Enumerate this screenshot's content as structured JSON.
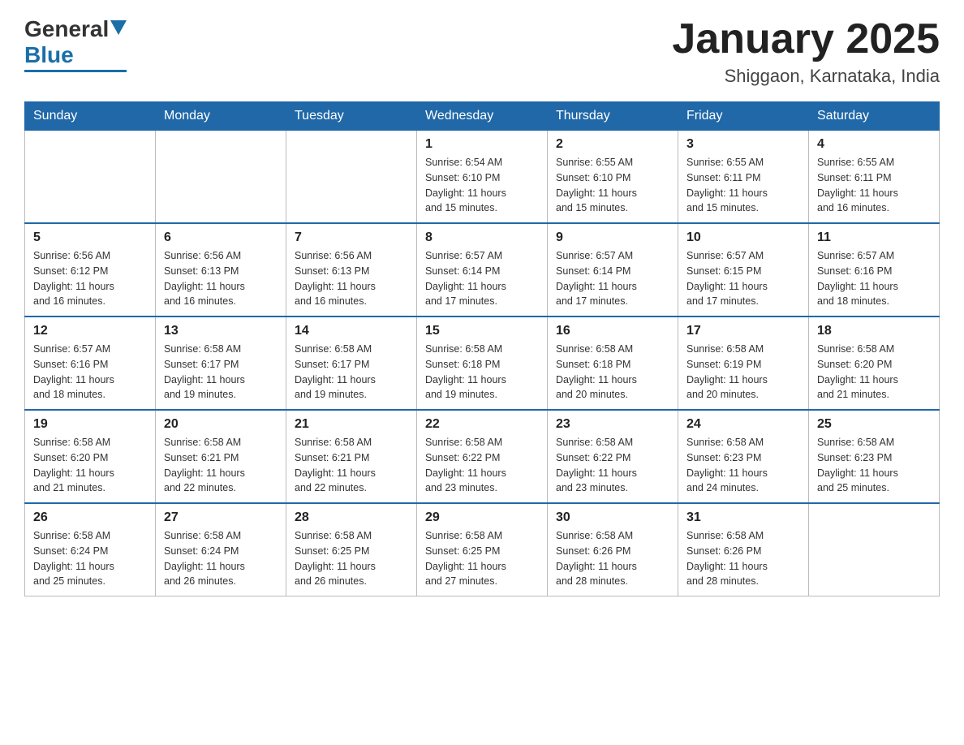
{
  "header": {
    "logo_general": "General",
    "logo_blue": "Blue",
    "title": "January 2025",
    "subtitle": "Shiggaon, Karnataka, India"
  },
  "days_of_week": [
    "Sunday",
    "Monday",
    "Tuesday",
    "Wednesday",
    "Thursday",
    "Friday",
    "Saturday"
  ],
  "weeks": [
    [
      {
        "day": "",
        "info": ""
      },
      {
        "day": "",
        "info": ""
      },
      {
        "day": "",
        "info": ""
      },
      {
        "day": "1",
        "info": "Sunrise: 6:54 AM\nSunset: 6:10 PM\nDaylight: 11 hours\nand 15 minutes."
      },
      {
        "day": "2",
        "info": "Sunrise: 6:55 AM\nSunset: 6:10 PM\nDaylight: 11 hours\nand 15 minutes."
      },
      {
        "day": "3",
        "info": "Sunrise: 6:55 AM\nSunset: 6:11 PM\nDaylight: 11 hours\nand 15 minutes."
      },
      {
        "day": "4",
        "info": "Sunrise: 6:55 AM\nSunset: 6:11 PM\nDaylight: 11 hours\nand 16 minutes."
      }
    ],
    [
      {
        "day": "5",
        "info": "Sunrise: 6:56 AM\nSunset: 6:12 PM\nDaylight: 11 hours\nand 16 minutes."
      },
      {
        "day": "6",
        "info": "Sunrise: 6:56 AM\nSunset: 6:13 PM\nDaylight: 11 hours\nand 16 minutes."
      },
      {
        "day": "7",
        "info": "Sunrise: 6:56 AM\nSunset: 6:13 PM\nDaylight: 11 hours\nand 16 minutes."
      },
      {
        "day": "8",
        "info": "Sunrise: 6:57 AM\nSunset: 6:14 PM\nDaylight: 11 hours\nand 17 minutes."
      },
      {
        "day": "9",
        "info": "Sunrise: 6:57 AM\nSunset: 6:14 PM\nDaylight: 11 hours\nand 17 minutes."
      },
      {
        "day": "10",
        "info": "Sunrise: 6:57 AM\nSunset: 6:15 PM\nDaylight: 11 hours\nand 17 minutes."
      },
      {
        "day": "11",
        "info": "Sunrise: 6:57 AM\nSunset: 6:16 PM\nDaylight: 11 hours\nand 18 minutes."
      }
    ],
    [
      {
        "day": "12",
        "info": "Sunrise: 6:57 AM\nSunset: 6:16 PM\nDaylight: 11 hours\nand 18 minutes."
      },
      {
        "day": "13",
        "info": "Sunrise: 6:58 AM\nSunset: 6:17 PM\nDaylight: 11 hours\nand 19 minutes."
      },
      {
        "day": "14",
        "info": "Sunrise: 6:58 AM\nSunset: 6:17 PM\nDaylight: 11 hours\nand 19 minutes."
      },
      {
        "day": "15",
        "info": "Sunrise: 6:58 AM\nSunset: 6:18 PM\nDaylight: 11 hours\nand 19 minutes."
      },
      {
        "day": "16",
        "info": "Sunrise: 6:58 AM\nSunset: 6:18 PM\nDaylight: 11 hours\nand 20 minutes."
      },
      {
        "day": "17",
        "info": "Sunrise: 6:58 AM\nSunset: 6:19 PM\nDaylight: 11 hours\nand 20 minutes."
      },
      {
        "day": "18",
        "info": "Sunrise: 6:58 AM\nSunset: 6:20 PM\nDaylight: 11 hours\nand 21 minutes."
      }
    ],
    [
      {
        "day": "19",
        "info": "Sunrise: 6:58 AM\nSunset: 6:20 PM\nDaylight: 11 hours\nand 21 minutes."
      },
      {
        "day": "20",
        "info": "Sunrise: 6:58 AM\nSunset: 6:21 PM\nDaylight: 11 hours\nand 22 minutes."
      },
      {
        "day": "21",
        "info": "Sunrise: 6:58 AM\nSunset: 6:21 PM\nDaylight: 11 hours\nand 22 minutes."
      },
      {
        "day": "22",
        "info": "Sunrise: 6:58 AM\nSunset: 6:22 PM\nDaylight: 11 hours\nand 23 minutes."
      },
      {
        "day": "23",
        "info": "Sunrise: 6:58 AM\nSunset: 6:22 PM\nDaylight: 11 hours\nand 23 minutes."
      },
      {
        "day": "24",
        "info": "Sunrise: 6:58 AM\nSunset: 6:23 PM\nDaylight: 11 hours\nand 24 minutes."
      },
      {
        "day": "25",
        "info": "Sunrise: 6:58 AM\nSunset: 6:23 PM\nDaylight: 11 hours\nand 25 minutes."
      }
    ],
    [
      {
        "day": "26",
        "info": "Sunrise: 6:58 AM\nSunset: 6:24 PM\nDaylight: 11 hours\nand 25 minutes."
      },
      {
        "day": "27",
        "info": "Sunrise: 6:58 AM\nSunset: 6:24 PM\nDaylight: 11 hours\nand 26 minutes."
      },
      {
        "day": "28",
        "info": "Sunrise: 6:58 AM\nSunset: 6:25 PM\nDaylight: 11 hours\nand 26 minutes."
      },
      {
        "day": "29",
        "info": "Sunrise: 6:58 AM\nSunset: 6:25 PM\nDaylight: 11 hours\nand 27 minutes."
      },
      {
        "day": "30",
        "info": "Sunrise: 6:58 AM\nSunset: 6:26 PM\nDaylight: 11 hours\nand 28 minutes."
      },
      {
        "day": "31",
        "info": "Sunrise: 6:58 AM\nSunset: 6:26 PM\nDaylight: 11 hours\nand 28 minutes."
      },
      {
        "day": "",
        "info": ""
      }
    ]
  ]
}
